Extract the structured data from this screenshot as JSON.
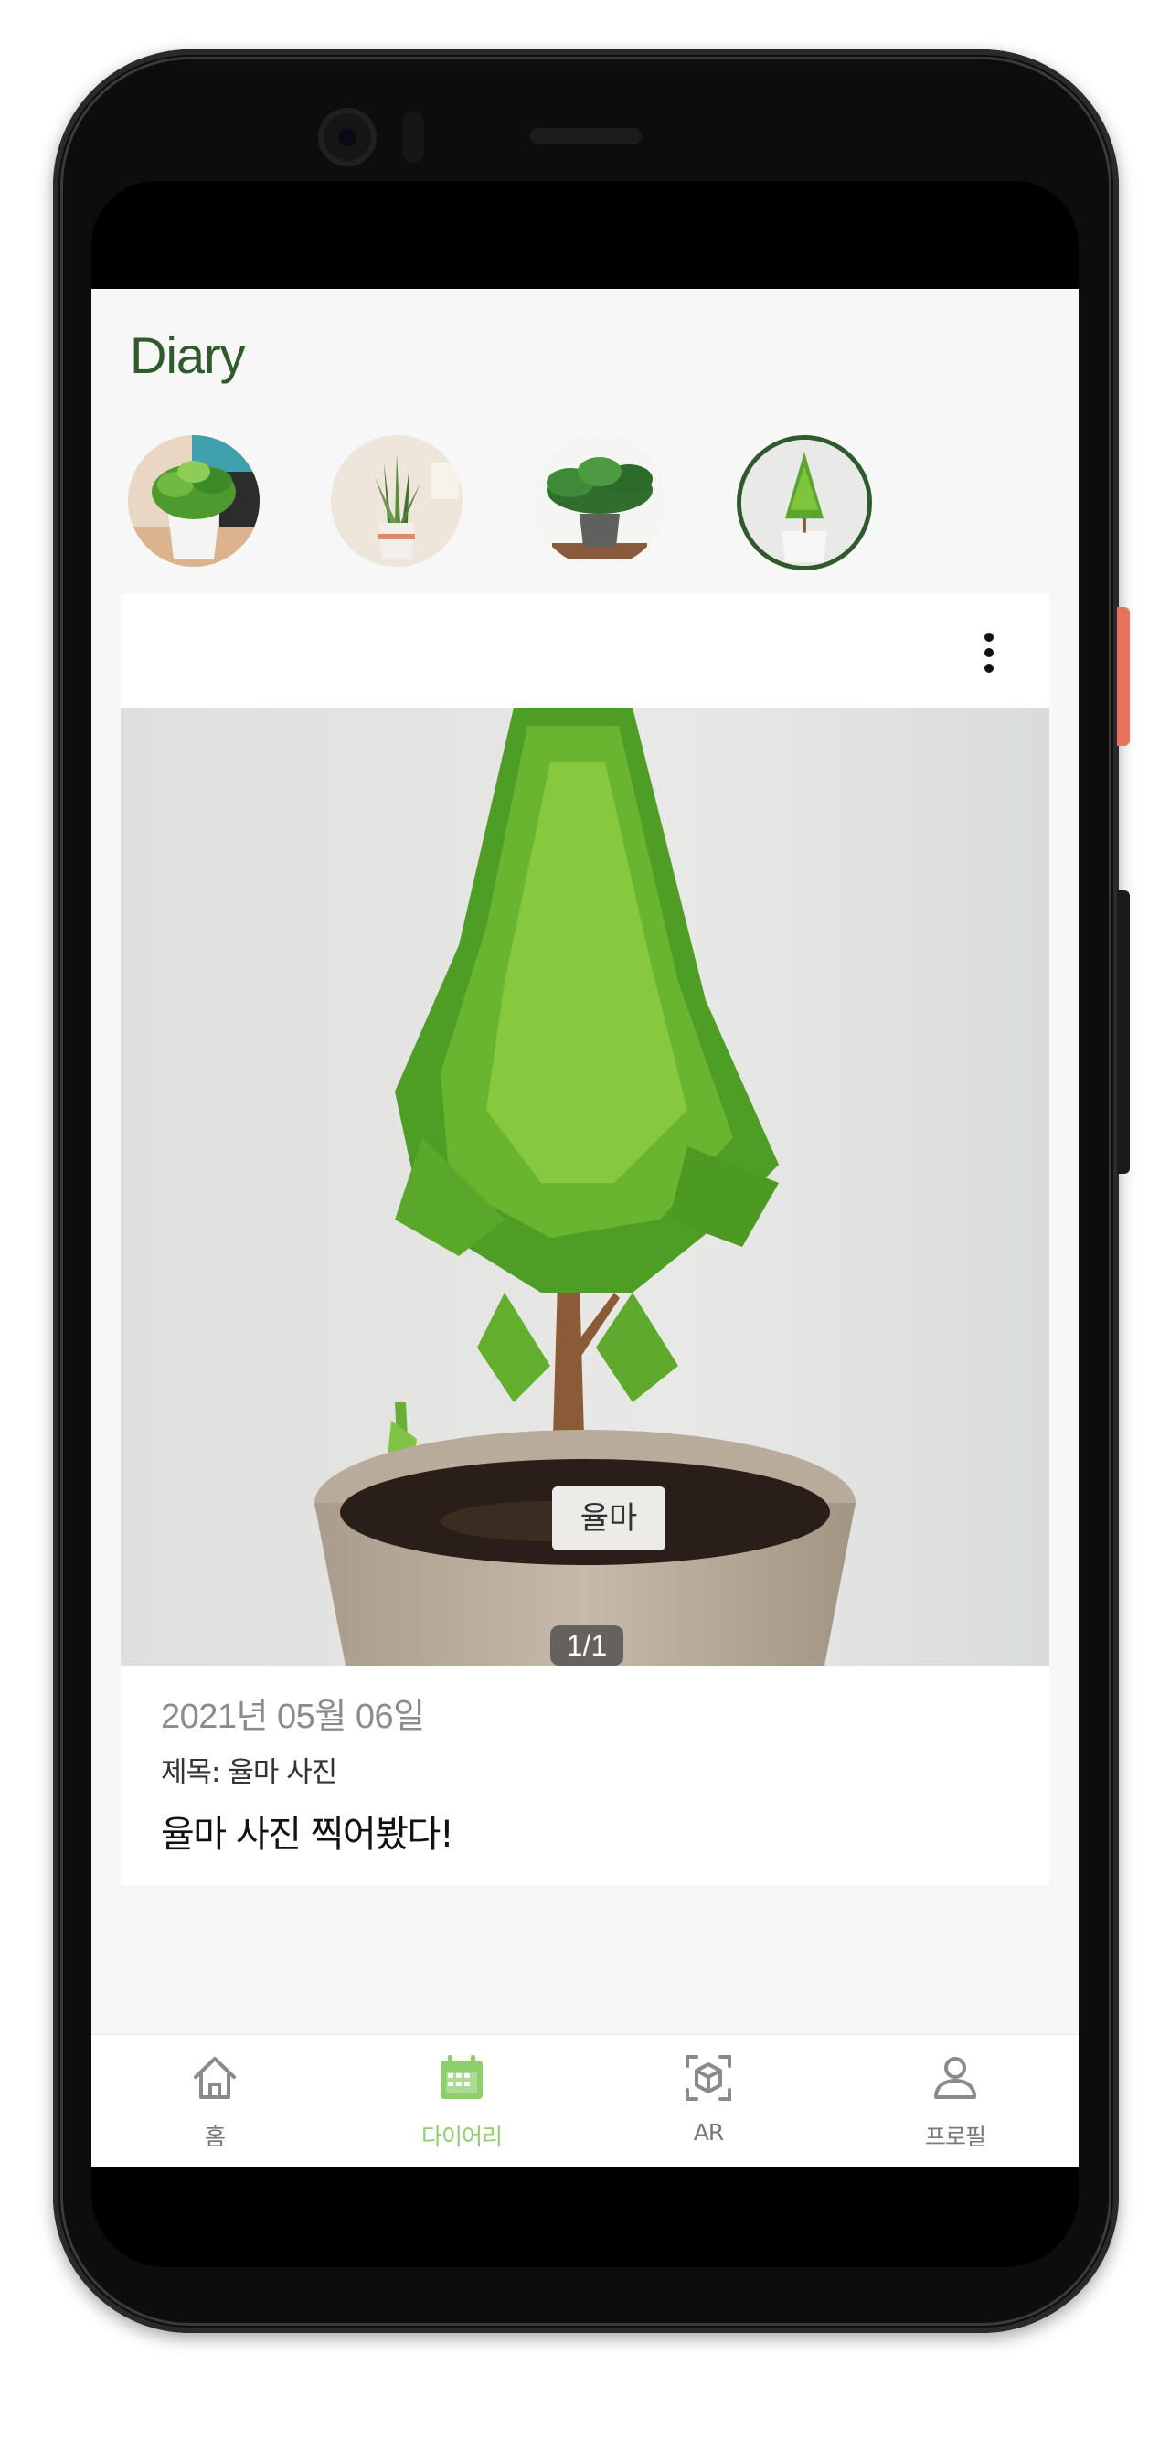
{
  "app": {
    "title": "Diary"
  },
  "plants": [
    {
      "name": "plant-1",
      "selected": false
    },
    {
      "name": "plant-2",
      "selected": false
    },
    {
      "name": "plant-3",
      "selected": false
    },
    {
      "name": "plant-4",
      "selected": true
    }
  ],
  "entry": {
    "menu_icon": "more-vertical-icon",
    "photo_indicator": "1/1",
    "date": "2021년 05월 06일",
    "title": "제목: 율마 사진",
    "body": "율마 사진 찍어봤다!",
    "pot_tag": "율마"
  },
  "bottom_nav": {
    "active_index": 1,
    "active_color": "#8fcf6b",
    "items": [
      {
        "label": "홈",
        "icon": "home-icon"
      },
      {
        "label": "다이어리",
        "icon": "calendar-icon"
      },
      {
        "label": "AR",
        "icon": "ar-cube-icon"
      },
      {
        "label": "프로필",
        "icon": "profile-icon"
      }
    ]
  },
  "colors": {
    "brand_green": "#2f5a2c",
    "accent_green": "#8fcf6b",
    "background": "#f7f7f7"
  }
}
